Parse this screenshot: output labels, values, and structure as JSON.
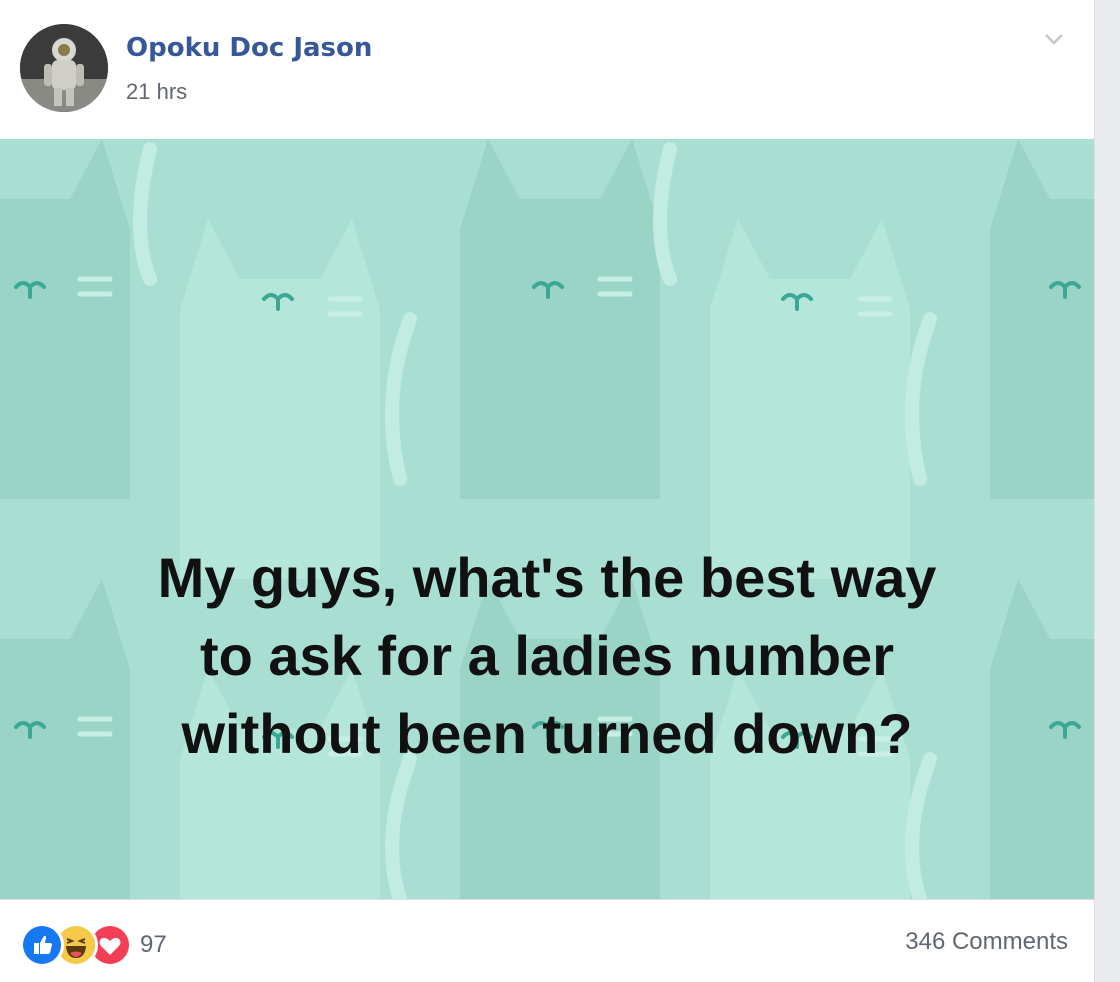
{
  "post": {
    "author": "Opoku Doc Jason",
    "timestamp": "21 hrs",
    "text_lines": [
      "My guys, what's the best way",
      "to ask for a ladies number",
      "without been turned down?"
    ],
    "background_colors": {
      "base": "#a8dfd2",
      "cat_dark": "#99d4c6",
      "cat_light": "#b5e6da",
      "whisker_accent": "#3aa893"
    }
  },
  "footer": {
    "reaction_icons": [
      "like-icon",
      "haha-icon",
      "love-icon"
    ],
    "reaction_count": "97",
    "comments_label": "346 Comments"
  },
  "icons": {
    "menu": "chevron-down-icon"
  }
}
